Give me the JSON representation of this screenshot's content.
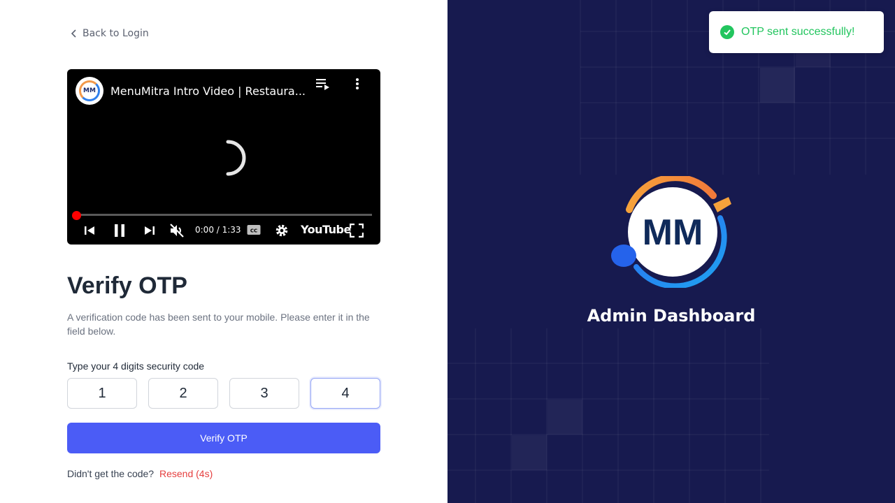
{
  "nav": {
    "back_label": "Back to Login"
  },
  "video": {
    "channel_avatar_text": "MM",
    "title": "MenuMitra Intro Video | Restaura...",
    "time": "0:00 / 1:33",
    "brand": "YouTube"
  },
  "form": {
    "heading": "Verify OTP",
    "description": "A verification code has been sent to your mobile. Please enter it in the field below.",
    "code_label": "Type your 4 digits security code",
    "digits": [
      "1",
      "2",
      "3",
      "4"
    ],
    "verify_label": "Verify OTP",
    "resend_prompt": "Didn't get the code?",
    "resend_label": "Resend (4s)"
  },
  "brand_panel": {
    "logo_text": "MM",
    "title": "Admin Dashboard"
  },
  "toast": {
    "message": "OTP sent successfully!"
  },
  "colors": {
    "primary": "#4b5cf6",
    "panel_bg": "#171a4f",
    "success": "#22c55e",
    "danger": "#e53e3e"
  }
}
